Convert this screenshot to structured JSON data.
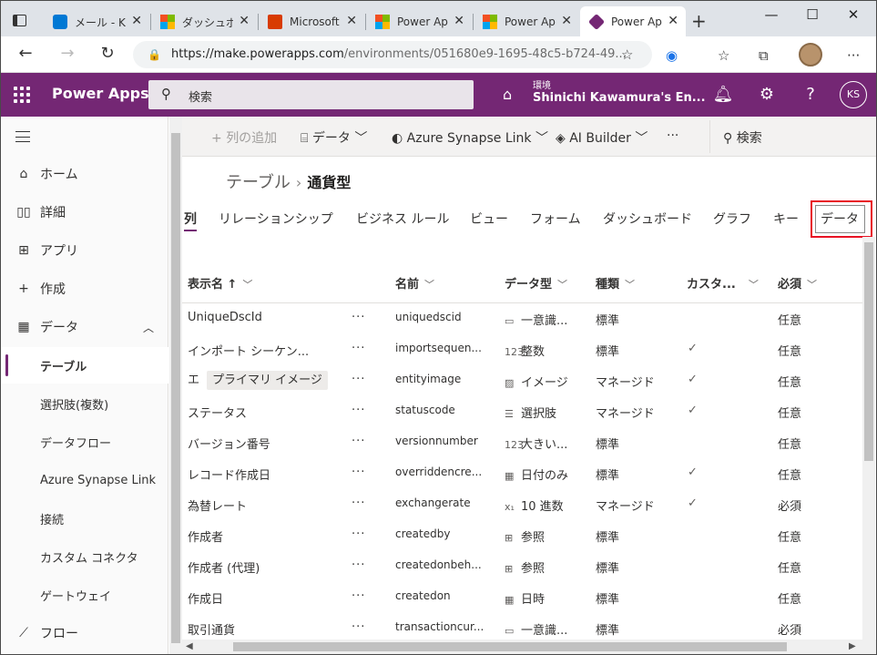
{
  "browser": {
    "tabs": [
      {
        "label": "メール - Ka",
        "icon": "outlook-icon",
        "color": "#0078d4"
      },
      {
        "label": "ダッシュボー",
        "icon": "microsoft-icon",
        "color": "#f25022"
      },
      {
        "label": "Microsoft",
        "icon": "office-icon",
        "color": "#d83b01"
      },
      {
        "label": "Power Ap",
        "icon": "microsoft-icon",
        "color": "#f25022"
      },
      {
        "label": "Power Ap",
        "icon": "microsoft-icon",
        "color": "#f25022"
      },
      {
        "label": "Power Ap",
        "icon": "power-apps-icon",
        "color": "#742774"
      }
    ],
    "url_host": "https://make.powerapps.com",
    "url_path": "/environments/051680e9-1695-48c5-b724-49..."
  },
  "header": {
    "app_title": "Power Apps",
    "search_placeholder": "検索",
    "env_label": "環境",
    "env_name": "Shinichi Kawamura's En...",
    "user_initials": "KS",
    "brand_color": "#742774"
  },
  "sidebar": {
    "items": [
      {
        "label": "ホーム",
        "icon": "home-icon"
      },
      {
        "label": "詳細",
        "icon": "book-icon"
      },
      {
        "label": "アプリ",
        "icon": "apps-icon"
      },
      {
        "label": "作成",
        "icon": "plus-icon"
      },
      {
        "label": "データ",
        "icon": "table-icon"
      },
      {
        "label": "テーブル"
      },
      {
        "label": "選択肢(複数)"
      },
      {
        "label": "データフロー"
      },
      {
        "label": "Azure Synapse Link"
      },
      {
        "label": "接続"
      },
      {
        "label": "カスタム コネクタ"
      },
      {
        "label": "ゲートウェイ"
      },
      {
        "label": "フロー",
        "icon": "flow-icon"
      }
    ]
  },
  "commandbar": {
    "add_column": "列の追加",
    "data": "データ",
    "synapse": "Azure Synapse Link",
    "ai_builder": "AI Builder",
    "more": "···",
    "search": "検索"
  },
  "breadcrumb": {
    "parent": "テーブル",
    "current": "通貨型"
  },
  "page_tabs": [
    "列",
    "リレーションシップ",
    "ビジネス ルール",
    "ビュー",
    "フォーム",
    "ダッシュボード",
    "グラフ",
    "キー",
    "データ"
  ],
  "table": {
    "headers": {
      "display_name": "表示名 ↑",
      "name": "名前",
      "data_type": "データ型",
      "kind": "種類",
      "custom": "カスタ...",
      "required": "必須"
    },
    "rows": [
      {
        "display": "UniqueDscId",
        "pill": "",
        "name": "uniquedscid",
        "type_icon": "▭",
        "type": "一意識...",
        "kind": "標準",
        "custom": "",
        "required": "任意"
      },
      {
        "display": "インポート シーケン...",
        "pill": "",
        "name": "importsequen...",
        "type_icon": "123",
        "type": "整数",
        "kind": "標準",
        "custom": "✓",
        "required": "任意"
      },
      {
        "display": "エ",
        "pill": "プライマリ イメージ",
        "name": "entityimage",
        "type_icon": "▨",
        "type": "イメージ",
        "kind": "マネージド",
        "custom": "✓",
        "required": "任意"
      },
      {
        "display": "ステータス",
        "pill": "",
        "name": "statuscode",
        "type_icon": "☰",
        "type": "選択肢",
        "kind": "マネージド",
        "custom": "✓",
        "required": "任意"
      },
      {
        "display": "バージョン番号",
        "pill": "",
        "name": "versionnumber",
        "type_icon": "123",
        "type": "大きい...",
        "kind": "標準",
        "custom": "",
        "required": "任意"
      },
      {
        "display": "レコード作成日",
        "pill": "",
        "name": "overriddencre...",
        "type_icon": "▦",
        "type": "日付のみ",
        "kind": "標準",
        "custom": "✓",
        "required": "任意"
      },
      {
        "display": "為替レート",
        "pill": "",
        "name": "exchangerate",
        "type_icon": "x₁",
        "type": "10 進数",
        "kind": "マネージド",
        "custom": "✓",
        "required": "必須"
      },
      {
        "display": "作成者",
        "pill": "",
        "name": "createdby",
        "type_icon": "⊞",
        "type": "参照",
        "kind": "標準",
        "custom": "",
        "required": "任意"
      },
      {
        "display": "作成者 (代理)",
        "pill": "",
        "name": "createdonbeh...",
        "type_icon": "⊞",
        "type": "参照",
        "kind": "標準",
        "custom": "",
        "required": "任意"
      },
      {
        "display": "作成日",
        "pill": "",
        "name": "createdon",
        "type_icon": "▦",
        "type": "日時",
        "kind": "標準",
        "custom": "",
        "required": "任意"
      },
      {
        "display": "取引通貨",
        "pill": "",
        "name": "transactioncur...",
        "type_icon": "▭",
        "type": "一意識...",
        "kind": "標準",
        "custom": "",
        "required": "必須"
      }
    ],
    "more_label": "···"
  }
}
